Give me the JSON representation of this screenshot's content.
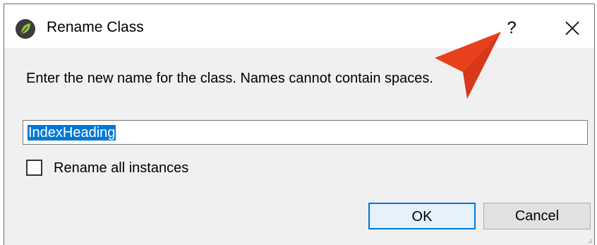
{
  "window": {
    "title": "Rename Class",
    "help_label": "?",
    "icon": "leaf-app-icon",
    "close_icon": "close-icon"
  },
  "prompt": "Enter the new name for the class. Names cannot contain spaces.",
  "name_input": {
    "value": "IndexHeading"
  },
  "rename_all": {
    "label": "Rename all instances",
    "checked": false
  },
  "buttons": {
    "ok": "OK",
    "cancel": "Cancel"
  },
  "colors": {
    "accent": "#0078d7",
    "pointer": "#e8401c",
    "icon_bg": "#3c3c3c",
    "icon_leaf": "#8cc63f"
  }
}
